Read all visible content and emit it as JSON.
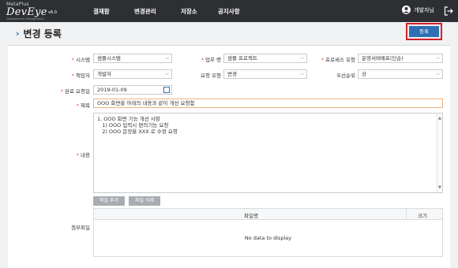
{
  "app": {
    "logo_top": "MetaPlus",
    "logo_main": "DevEye",
    "logo_version": "v6.0",
    "logo_sub": "Development Management"
  },
  "nav": {
    "items": [
      {
        "label": "결재함"
      },
      {
        "label": "변경관리"
      },
      {
        "label": "저장소"
      },
      {
        "label": "공지사항"
      }
    ]
  },
  "user": {
    "name": "개발자님"
  },
  "page": {
    "title": "변경 등록",
    "register_label": "등록"
  },
  "form": {
    "system": {
      "label": "시스템",
      "value": "샘플시스템"
    },
    "task_name": {
      "label": "업무 명",
      "value": "샘플 프로젝트"
    },
    "process_type": {
      "label": "프로세스 유형",
      "value": "운영서버배포(단순)"
    },
    "owner": {
      "label": "책임자",
      "value": "개발자"
    },
    "request_type": {
      "label": "요청 유형",
      "value": "변경"
    },
    "priority": {
      "label": "우선순위",
      "value": "상"
    },
    "due_date": {
      "label": "완료 요청일",
      "value": "2019-01-09"
    },
    "subject": {
      "label": "제목",
      "value": "OOO 화면을 아래의 내용과 같이 개선 요청함"
    },
    "content": {
      "label": "내용",
      "lines": [
        "1. OOO 화면 기능 개선 사항",
        "   1) OOO 입력시 편의기능 요청",
        "   2) OOO 문장을 XXX 로 수정 요청"
      ]
    },
    "attachment": {
      "label": "첨부파일",
      "add_label": "파일 추가",
      "delete_label": "파일 삭제",
      "col_name": "파일명",
      "col_size": "크기",
      "empty_text": "No data to display"
    }
  },
  "colors": {
    "topbar": "#2d2f33",
    "accent": "#2f6fb3",
    "required": "#e1572d",
    "highlight_border": "#d3202a"
  }
}
